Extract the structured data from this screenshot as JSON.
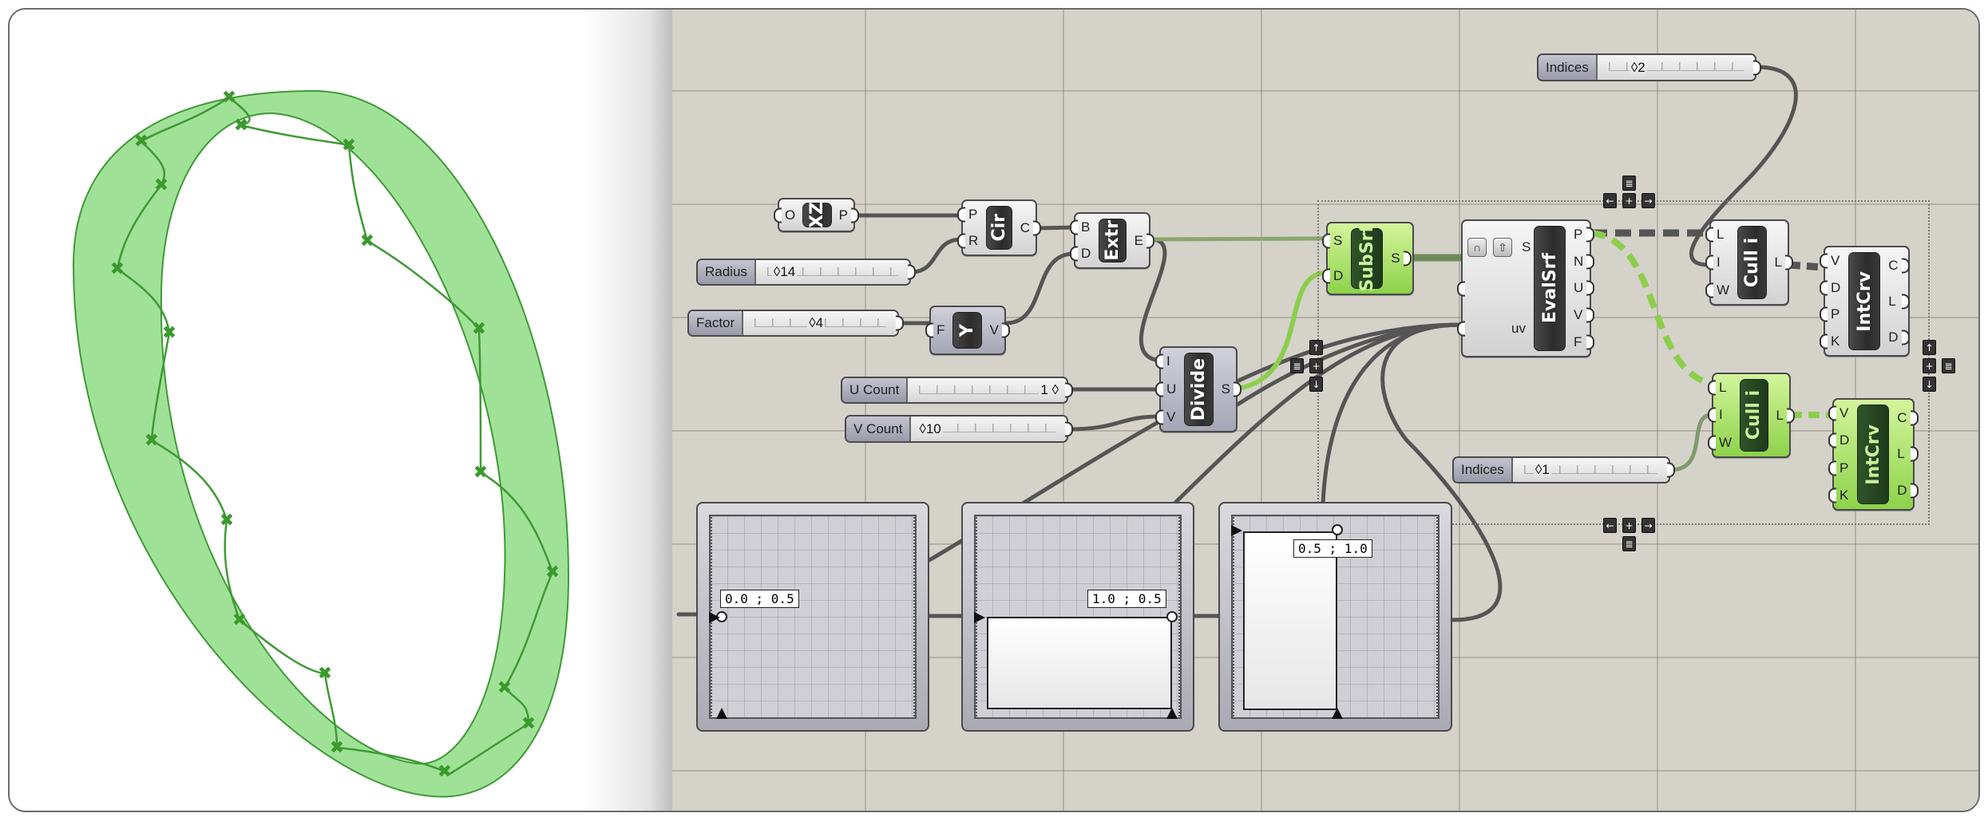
{
  "colors": {
    "canvas": "#d5d2ca",
    "ring_fill": "#8fdc86",
    "ring_stroke": "#3f9a35",
    "marker": "#3a9a2c",
    "wire": "#555555",
    "wire_selected": "#8cce4c",
    "node_green": "#a6e063"
  },
  "viewport": {
    "object": "extruded-circle-surface",
    "markers": "division points"
  },
  "nodes": {
    "xz": {
      "label": "XZ",
      "inputs": [
        "O"
      ],
      "outputs": [
        "P"
      ]
    },
    "cir": {
      "label": "Cir",
      "inputs": [
        "P",
        "R"
      ],
      "outputs": [
        "C"
      ]
    },
    "extr": {
      "label": "Extr",
      "inputs": [
        "B",
        "D"
      ],
      "outputs": [
        "E"
      ]
    },
    "y": {
      "label": "Y",
      "inputs": [
        "F"
      ],
      "outputs": [
        "V"
      ]
    },
    "divide": {
      "label": "Divide",
      "inputs": [
        "I",
        "U",
        "V"
      ],
      "outputs": [
        "S"
      ]
    },
    "subsrf": {
      "label": "SubSrf",
      "inputs": [
        "S",
        "D"
      ],
      "outputs": [
        "S"
      ]
    },
    "evalsrf": {
      "label": "EvalSrf",
      "inputs": [
        "S",
        "uv"
      ],
      "outputs": [
        "P",
        "N",
        "U",
        "V",
        "F"
      ]
    },
    "cull_top": {
      "label": "Cull i",
      "inputs": [
        "L",
        "I",
        "W"
      ],
      "outputs": [
        "L"
      ]
    },
    "cull_bottom": {
      "label": "Cull i",
      "inputs": [
        "L",
        "I",
        "W"
      ],
      "outputs": [
        "L"
      ]
    },
    "intcrv_top": {
      "label": "IntCrv",
      "inputs": [
        "V",
        "D",
        "P",
        "K"
      ],
      "outputs": [
        "C",
        "L",
        "D"
      ]
    },
    "intcrv_bottom": {
      "label": "IntCrv",
      "inputs": [
        "V",
        "D",
        "P",
        "K"
      ],
      "outputs": [
        "C",
        "L",
        "D"
      ]
    }
  },
  "sliders": {
    "radius": {
      "label": "Radius",
      "value": "◊14"
    },
    "factor": {
      "label": "Factor",
      "value": "◊4"
    },
    "u_count": {
      "label": "U Count",
      "value": "1 ◊"
    },
    "v_count": {
      "label": "V Count",
      "value": "◊10"
    },
    "indices_top": {
      "label": "Indices",
      "value": "◊2"
    },
    "indices_bottom": {
      "label": "Indices",
      "value": "◊1"
    }
  },
  "mappers": [
    {
      "point": "0.0 ; 0.5"
    },
    {
      "point": "1.0 ; 0.5"
    },
    {
      "point": "0.5 ; 1.0"
    }
  ],
  "group_buttons": {
    "left": "←",
    "right": "→",
    "up": "↑",
    "down": "↓",
    "center": "+",
    "list": "≣"
  }
}
